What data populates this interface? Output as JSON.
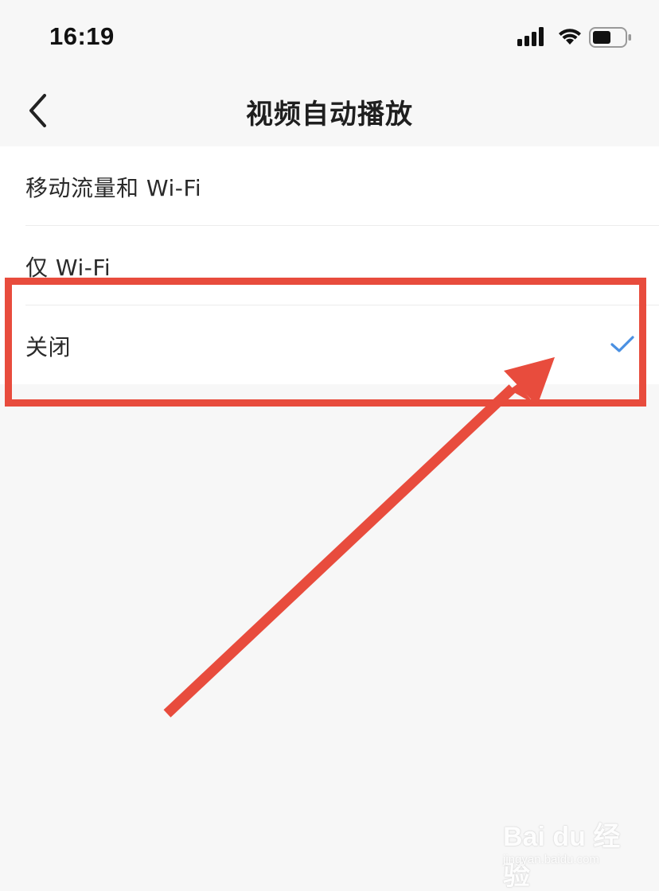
{
  "status_bar": {
    "time": "16:19",
    "icons": [
      "cellular-signal-icon",
      "wifi-icon",
      "battery-icon"
    ]
  },
  "nav": {
    "title": "视频自动播放",
    "back_icon": "chevron-left-icon"
  },
  "options": [
    {
      "label": "移动流量和 Wi-Fi",
      "selected": false
    },
    {
      "label": "仅 Wi-Fi",
      "selected": false
    },
    {
      "label": "关闭",
      "selected": true
    }
  ],
  "colors": {
    "accent_check": "#4a90e2",
    "annotation_red": "#e84c3d",
    "background": "#f7f7f7"
  },
  "watermark": {
    "brand": "Bai du 经验",
    "url": "jingyan.baidu.com"
  }
}
